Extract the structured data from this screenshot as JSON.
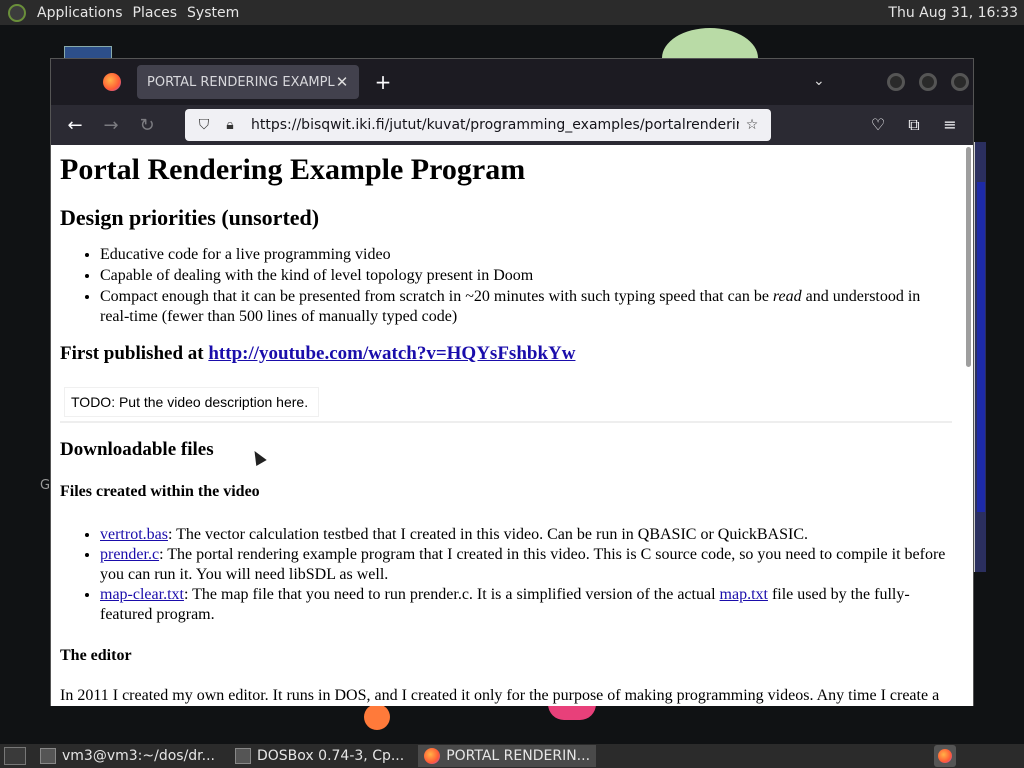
{
  "panel": {
    "menus": [
      "Applications",
      "Places",
      "System"
    ],
    "clock": "Thu Aug 31, 16:33"
  },
  "desktop": {
    "partial_letter": "G"
  },
  "browser": {
    "tab_title": "PORTAL RENDERING EXAMPLE",
    "close_glyph": "✕",
    "new_tab_glyph": "+",
    "list_tabs_glyph": "⌄",
    "back_glyph": "←",
    "forward_glyph": "→",
    "reload_glyph": "↻",
    "url": "https://bisqwit.iki.fi/jutut/kuvat/programming_examples/portalrendering.html",
    "star_glyph": "☆",
    "pocket_glyph": "♡",
    "extensions_glyph": "⧉",
    "menu_glyph": "≡"
  },
  "page": {
    "title": "Portal Rendering Example Program",
    "design_heading": "Design priorities (unsorted)",
    "priorities": [
      "Educative code for a live programming video",
      "Capable of dealing with the kind of level topology present in Doom"
    ],
    "priority3_a": "Compact enough that it can be presented from scratch in ~20 minutes with such typing speed that can be ",
    "priority3_em": "read",
    "priority3_b": " and understood in real-time (fewer than 500 lines of manually typed code)",
    "published_label": "First published at ",
    "published_link": "http://youtube.com/watch?v=HQYsFshbkYw",
    "todo": "TODO: Put the video description here.",
    "downloads_heading": "Downloadable files",
    "files_heading": "Files created within the video",
    "files": [
      {
        "link": "vertrot.bas",
        "text": ": The vector calculation testbed that I created in this video. Can be run in QBASIC or QuickBASIC."
      },
      {
        "link": "prender.c",
        "text": ": The portal rendering example program that I created in this video. This is C source code, so you need to compile it before you can run it. You will need libSDL as well."
      }
    ],
    "file3_link": "map-clear.txt",
    "file3_text_a": ": The map file that you need to run prender.c. It is a simplified version of the actual ",
    "file3_link2": "map.txt",
    "file3_text_b": " file used by the fully-featured program.",
    "editor_heading": "The editor",
    "editor_text": "In 2011 I created my own editor. It runs in DOS, and I created it only for the purpose of making programming videos. Any time I create a"
  },
  "taskbar": {
    "items": [
      "vm3@vm3:~/dos/dr...",
      "DOSBox 0.74-3, Cp...",
      "PORTAL RENDERIN..."
    ]
  }
}
